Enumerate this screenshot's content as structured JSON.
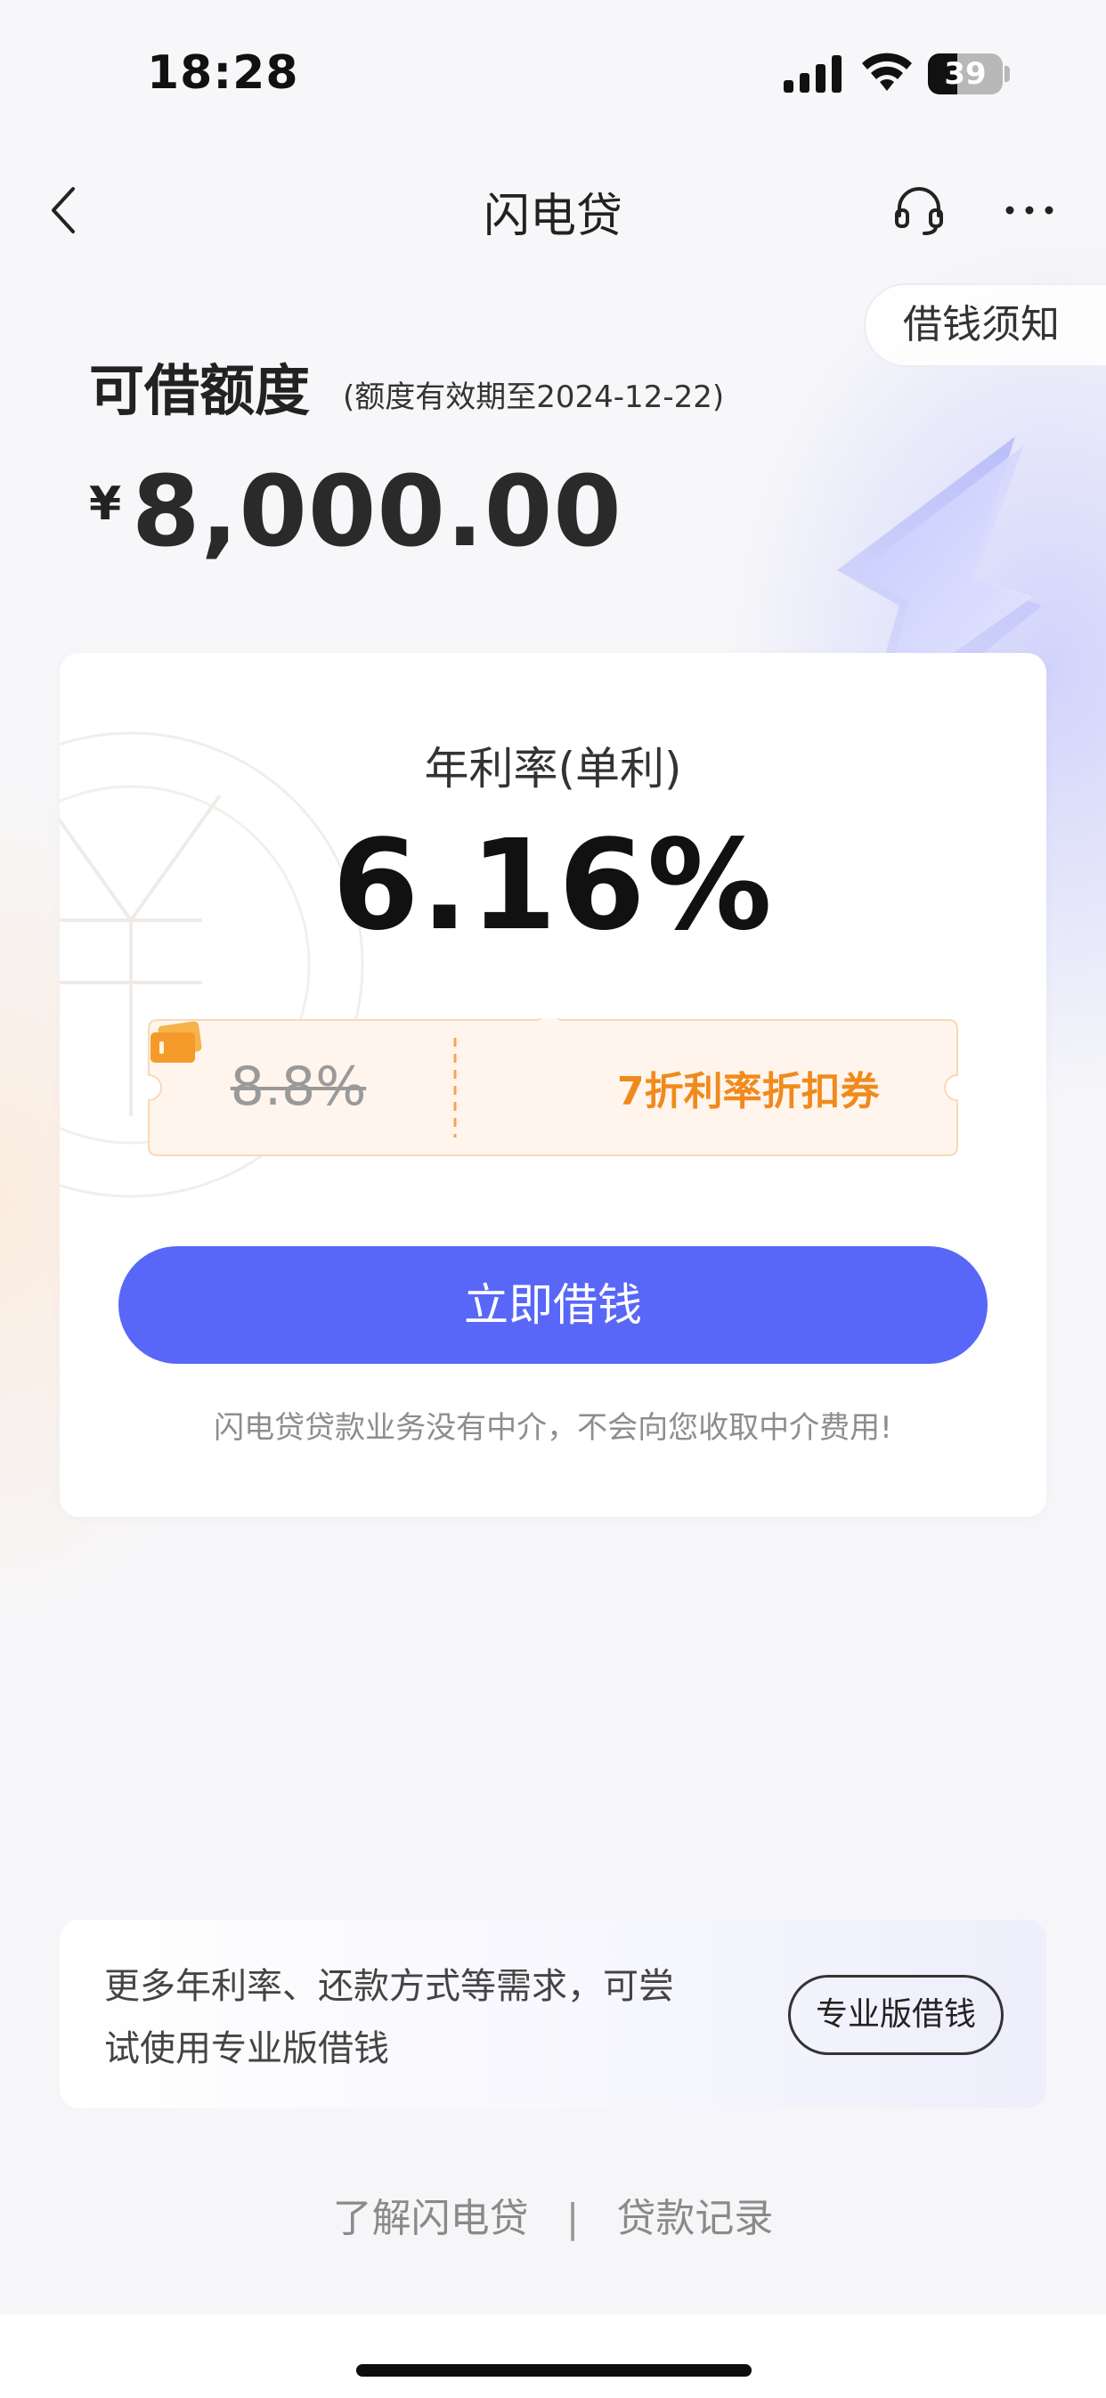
{
  "status_bar": {
    "time": "18:28",
    "battery": "39",
    "battery_level": 0.39
  },
  "nav": {
    "title": "闪电贷",
    "notice_label": "借钱须知",
    "icons": {
      "back": "chevron-left-icon",
      "service": "headset-icon",
      "more": "more-icon"
    }
  },
  "quota": {
    "label": "可借额度",
    "validity": "(额度有效期至2024-12-22)",
    "currency": "¥",
    "amount": "8,000.00"
  },
  "rate_card": {
    "label": "年利率(单利)",
    "rate": "6.16%",
    "original_rate": "8.8%",
    "coupon_text": "7折利率折扣券",
    "button": "立即借钱",
    "disclaimer": "闪电贷贷款业务没有中介，不会向您收取中介费用!"
  },
  "pro": {
    "text": "更多年利率、还款方式等需求，可尝试使用专业版借钱",
    "button": "专业版借钱"
  },
  "footer": {
    "link1": "了解闪电贷",
    "separator": "|",
    "link2": "贷款记录"
  },
  "colors": {
    "primary": "#5867f8",
    "coupon_orange": "#f08a1c",
    "coupon_bg": "#fff5ec"
  }
}
